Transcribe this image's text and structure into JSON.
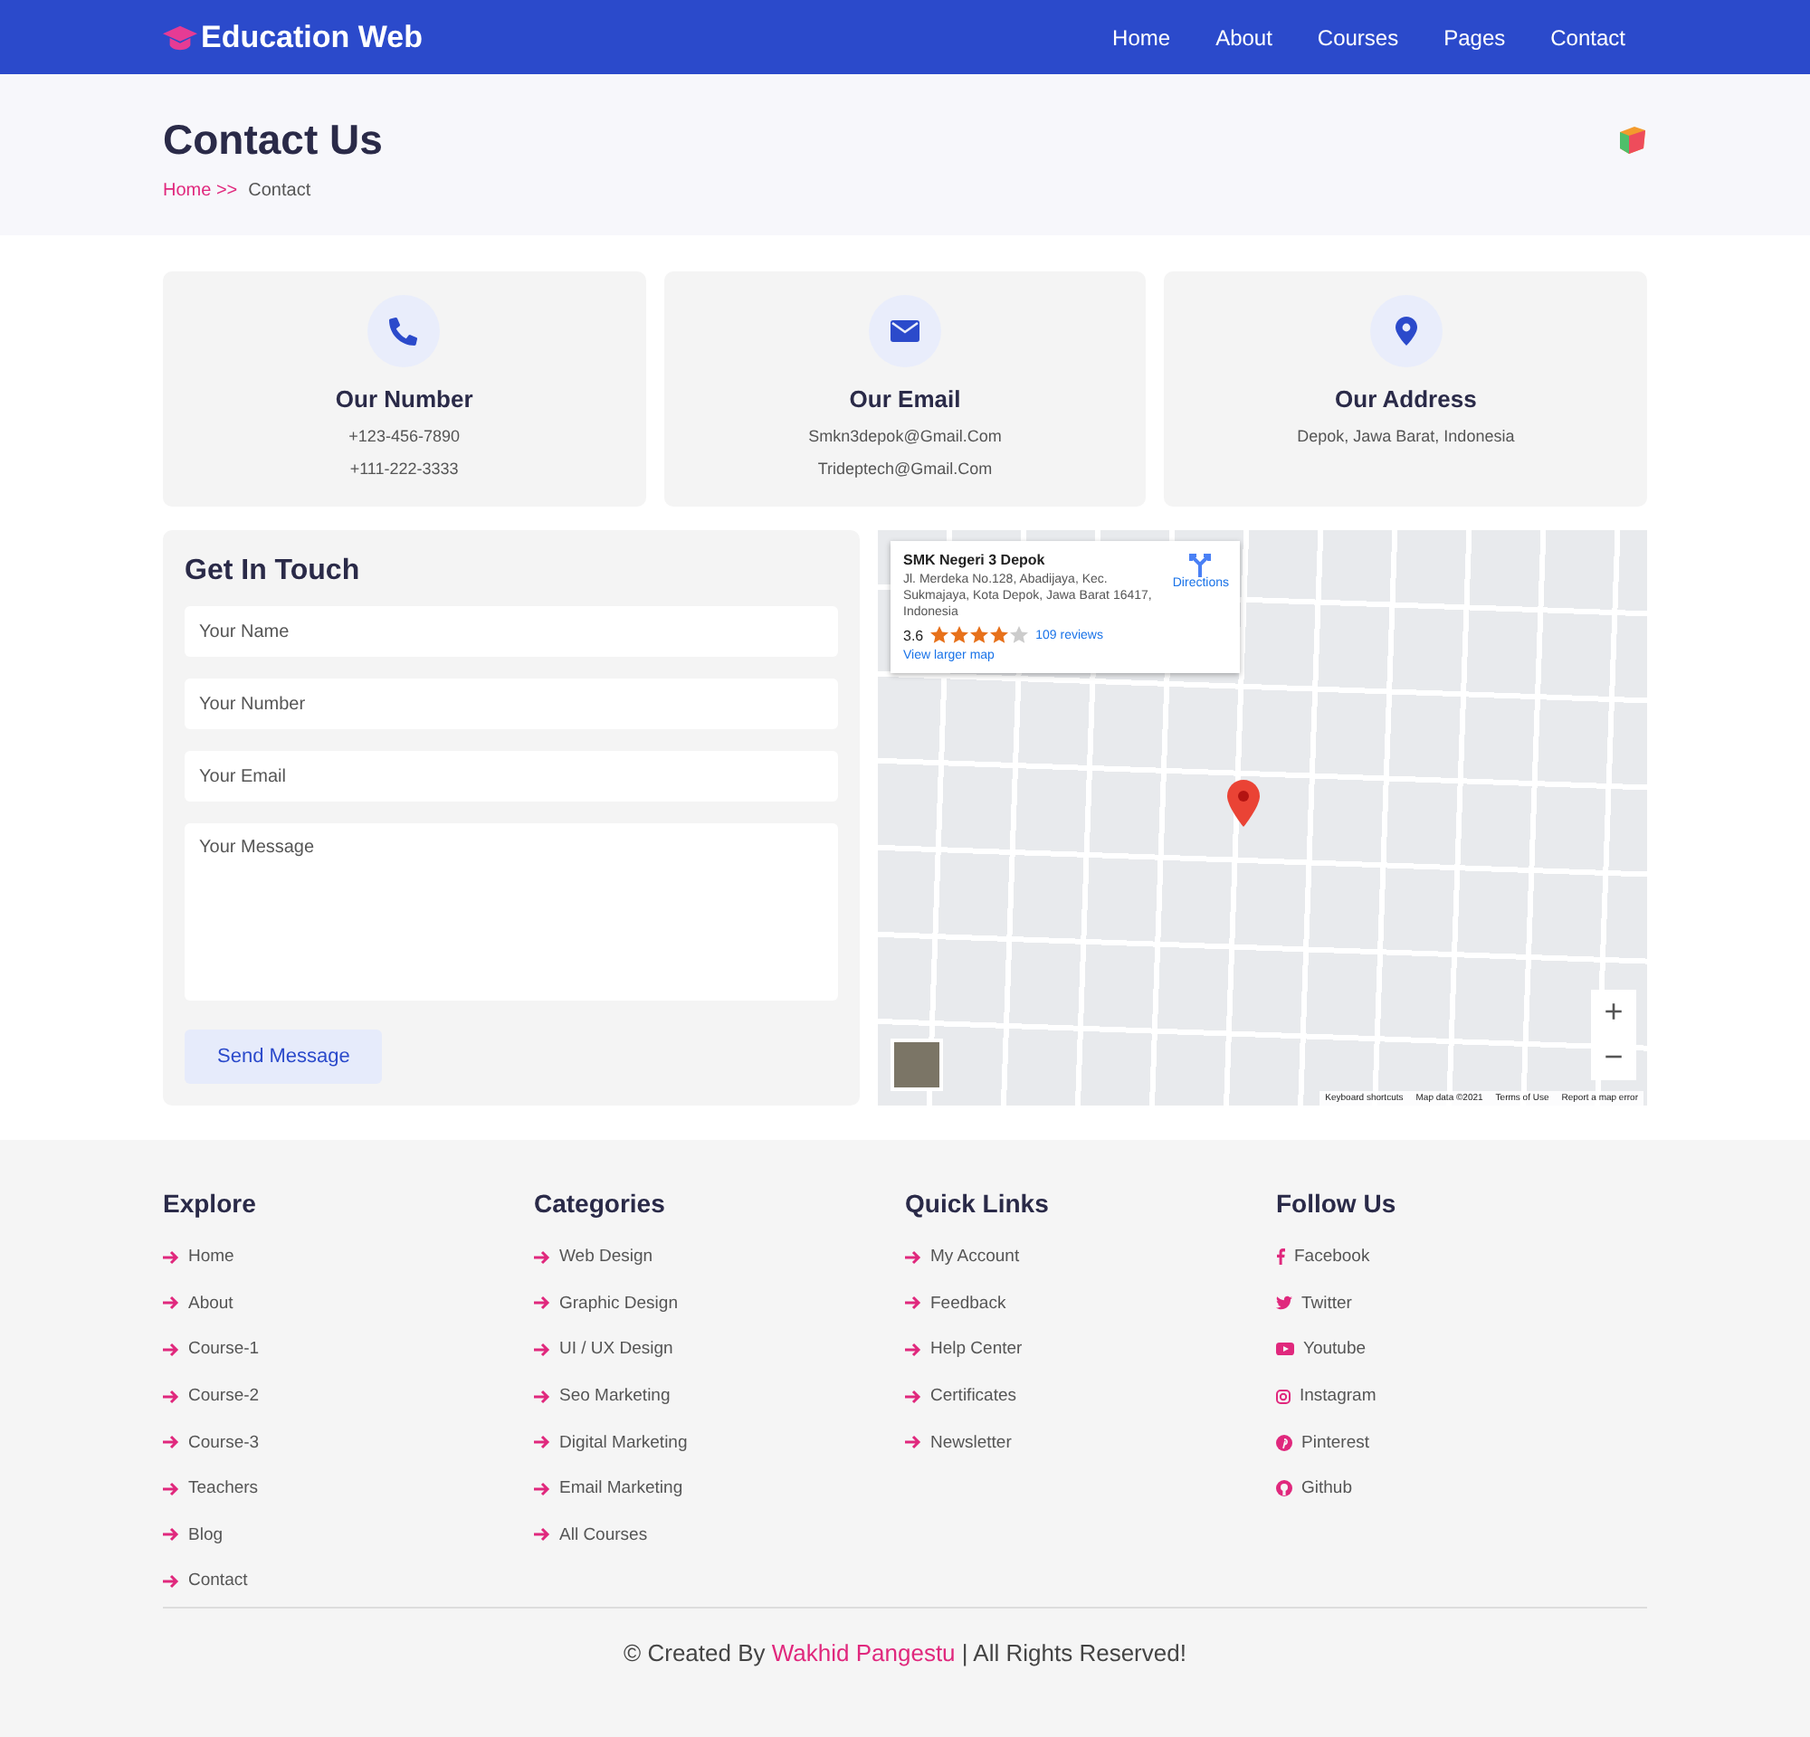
{
  "navbar": {
    "brand": "Education Web",
    "links": [
      {
        "label": "Home",
        "selected": false
      },
      {
        "label": "About",
        "selected": false
      },
      {
        "label": "Courses",
        "selected": false
      },
      {
        "label": "Pages",
        "selected": false
      },
      {
        "label": "Contact",
        "selected": false
      }
    ]
  },
  "page_header": {
    "title": "Contact Us",
    "breadcrumb": [
      {
        "label": "Home >>",
        "kind": "link"
      },
      {
        "label": "Contact",
        "kind": "current"
      }
    ]
  },
  "info_cards": [
    {
      "kind": "phone",
      "title": "Our Number",
      "lines": [
        "+123-456-7890",
        "+111-222-3333"
      ]
    },
    {
      "kind": "email",
      "title": "Our Email",
      "lines": [
        "Smkn3depok@Gmail.Com",
        "Trideptech@Gmail.Com"
      ]
    },
    {
      "kind": "address",
      "title": "Our Address",
      "lines": [
        "Depok, Jawa Barat, Indonesia"
      ]
    }
  ],
  "contact_form": {
    "title": "Get In Touch",
    "fields": [
      {
        "placeholder": "Your Name",
        "kind": "input"
      },
      {
        "placeholder": "Your Number",
        "kind": "input"
      },
      {
        "placeholder": "Your Email",
        "kind": "input"
      },
      {
        "placeholder": "Your Message",
        "kind": "textarea"
      }
    ],
    "button": "Send Message"
  },
  "map": {
    "place": {
      "name": "SMK Negeri 3 Depok",
      "address": "Jl. Merdeka No.128, Abadijaya, Kec. Sukmajaya, Kota Depok, Jawa Barat 16417, Indonesia",
      "rating": "3.6",
      "stars": 4,
      "reviews": "109 reviews",
      "directions": "Directions",
      "larger_map": "View larger map"
    },
    "zoom_in": "+",
    "zoom_out": "−",
    "attribution": [
      "Keyboard shortcuts",
      "Map data ©2021",
      "Terms of Use",
      "Report a map error"
    ]
  },
  "footer": {
    "columns": [
      {
        "title": "Explore",
        "kind": "arrows",
        "items": [
          {
            "label": "Home"
          },
          {
            "label": "About"
          },
          {
            "label": "Course-1"
          },
          {
            "label": "Course-2"
          },
          {
            "label": "Course-3"
          },
          {
            "label": "Teachers"
          },
          {
            "label": "Blog"
          },
          {
            "label": "Contact"
          }
        ]
      },
      {
        "title": "Categories",
        "kind": "arrows",
        "items": [
          {
            "label": "Web Design"
          },
          {
            "label": "Graphic Design"
          },
          {
            "label": "UI / UX Design"
          },
          {
            "label": "Seo Marketing"
          },
          {
            "label": "Digital Marketing"
          },
          {
            "label": "Email Marketing"
          },
          {
            "label": "All Courses"
          }
        ]
      },
      {
        "title": "Quick Links",
        "kind": "arrows",
        "items": [
          {
            "label": "My Account"
          },
          {
            "label": "Feedback"
          },
          {
            "label": "Help Center"
          },
          {
            "label": "Certificates"
          },
          {
            "label": "Newsletter"
          }
        ]
      },
      {
        "title": "Follow Us",
        "kind": "social",
        "items": [
          {
            "label": "Facebook"
          },
          {
            "label": "Twitter"
          },
          {
            "label": "Youtube"
          },
          {
            "label": "Instagram"
          },
          {
            "label": "Pinterest"
          },
          {
            "label": "Github"
          }
        ]
      }
    ],
    "credit": {
      "prefix": "© Created By",
      "author": "Wakhid Pangestu",
      "suffix": "| All Rights Reserved!"
    }
  }
}
